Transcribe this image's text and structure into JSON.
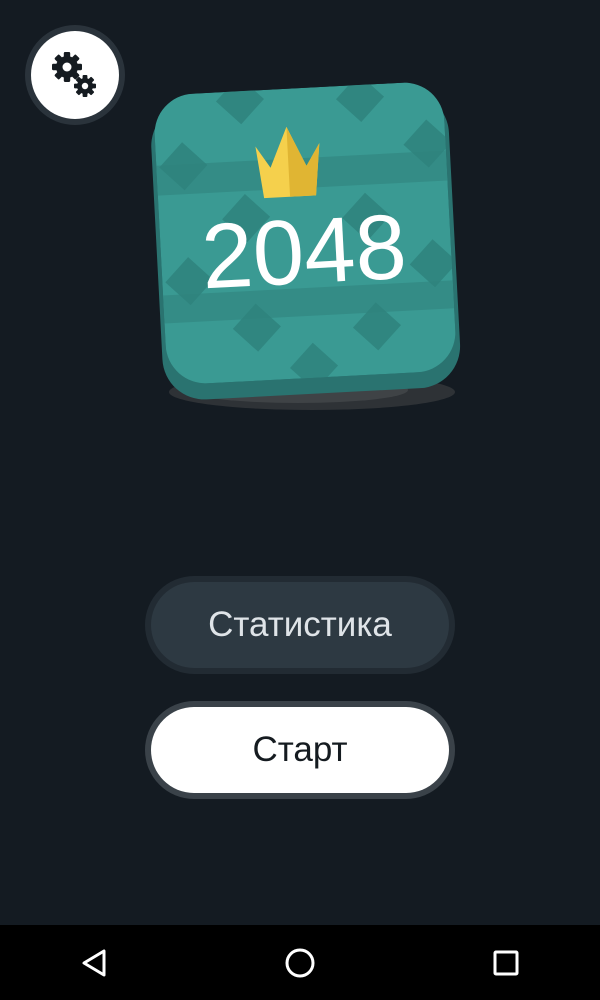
{
  "logo": {
    "text": "2048",
    "icon": "crown-icon",
    "tile_color": "#3a9a93",
    "crown_color": "#f5d04c"
  },
  "settings": {
    "icon": "gears-icon"
  },
  "buttons": {
    "stats_label": "Статистика",
    "start_label": "Старт"
  },
  "navbar": {
    "back_icon": "back-triangle-icon",
    "home_icon": "home-circle-icon",
    "recents_icon": "recents-square-icon"
  }
}
